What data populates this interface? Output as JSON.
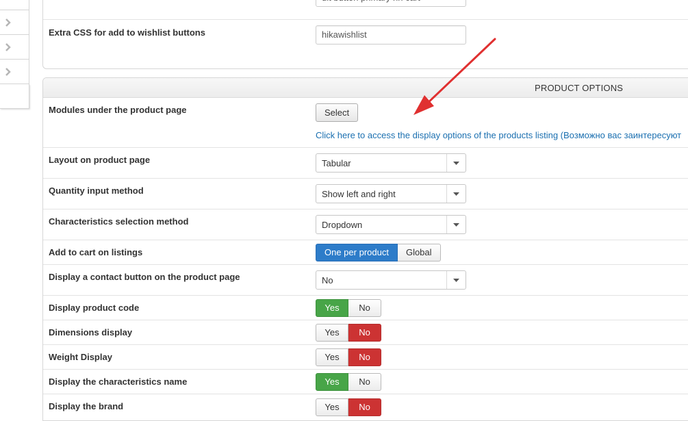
{
  "top_panel": {
    "prev_field_value": "ult button primary hh cart",
    "wishlist_label": "Extra CSS for add to wishlist buttons",
    "wishlist_value": "hikawishlist"
  },
  "section": {
    "title": "PRODUCT OPTIONS",
    "modules_label": "Modules under the product page",
    "select_button": "Select",
    "listing_link": "Click here to access the display options of the products listing (Возможно вас заинтересуют",
    "layout_label": "Layout on product page",
    "layout_value": "Tabular",
    "quantity_label": "Quantity input method",
    "quantity_value": "Show left and right",
    "characteristics_label": "Characteristics selection method",
    "characteristics_value": "Dropdown",
    "add_to_cart_label": "Add to cart on listings",
    "add_to_cart_options": [
      "One per product",
      "Global"
    ],
    "add_to_cart_selected": "One per product",
    "contact_label": "Display a contact button on the product page",
    "contact_value": "No",
    "code_label": "Display product code",
    "dimensions_label": "Dimensions display",
    "weight_label": "Weight Display",
    "char_name_label": "Display the characteristics name",
    "brand_label": "Display the brand",
    "yes": "Yes",
    "no": "No"
  },
  "colors": {
    "accent_blue": "#2d7cc9",
    "yes_green": "#48a548",
    "no_red": "#cc3333",
    "arrow_red": "#e03030"
  }
}
